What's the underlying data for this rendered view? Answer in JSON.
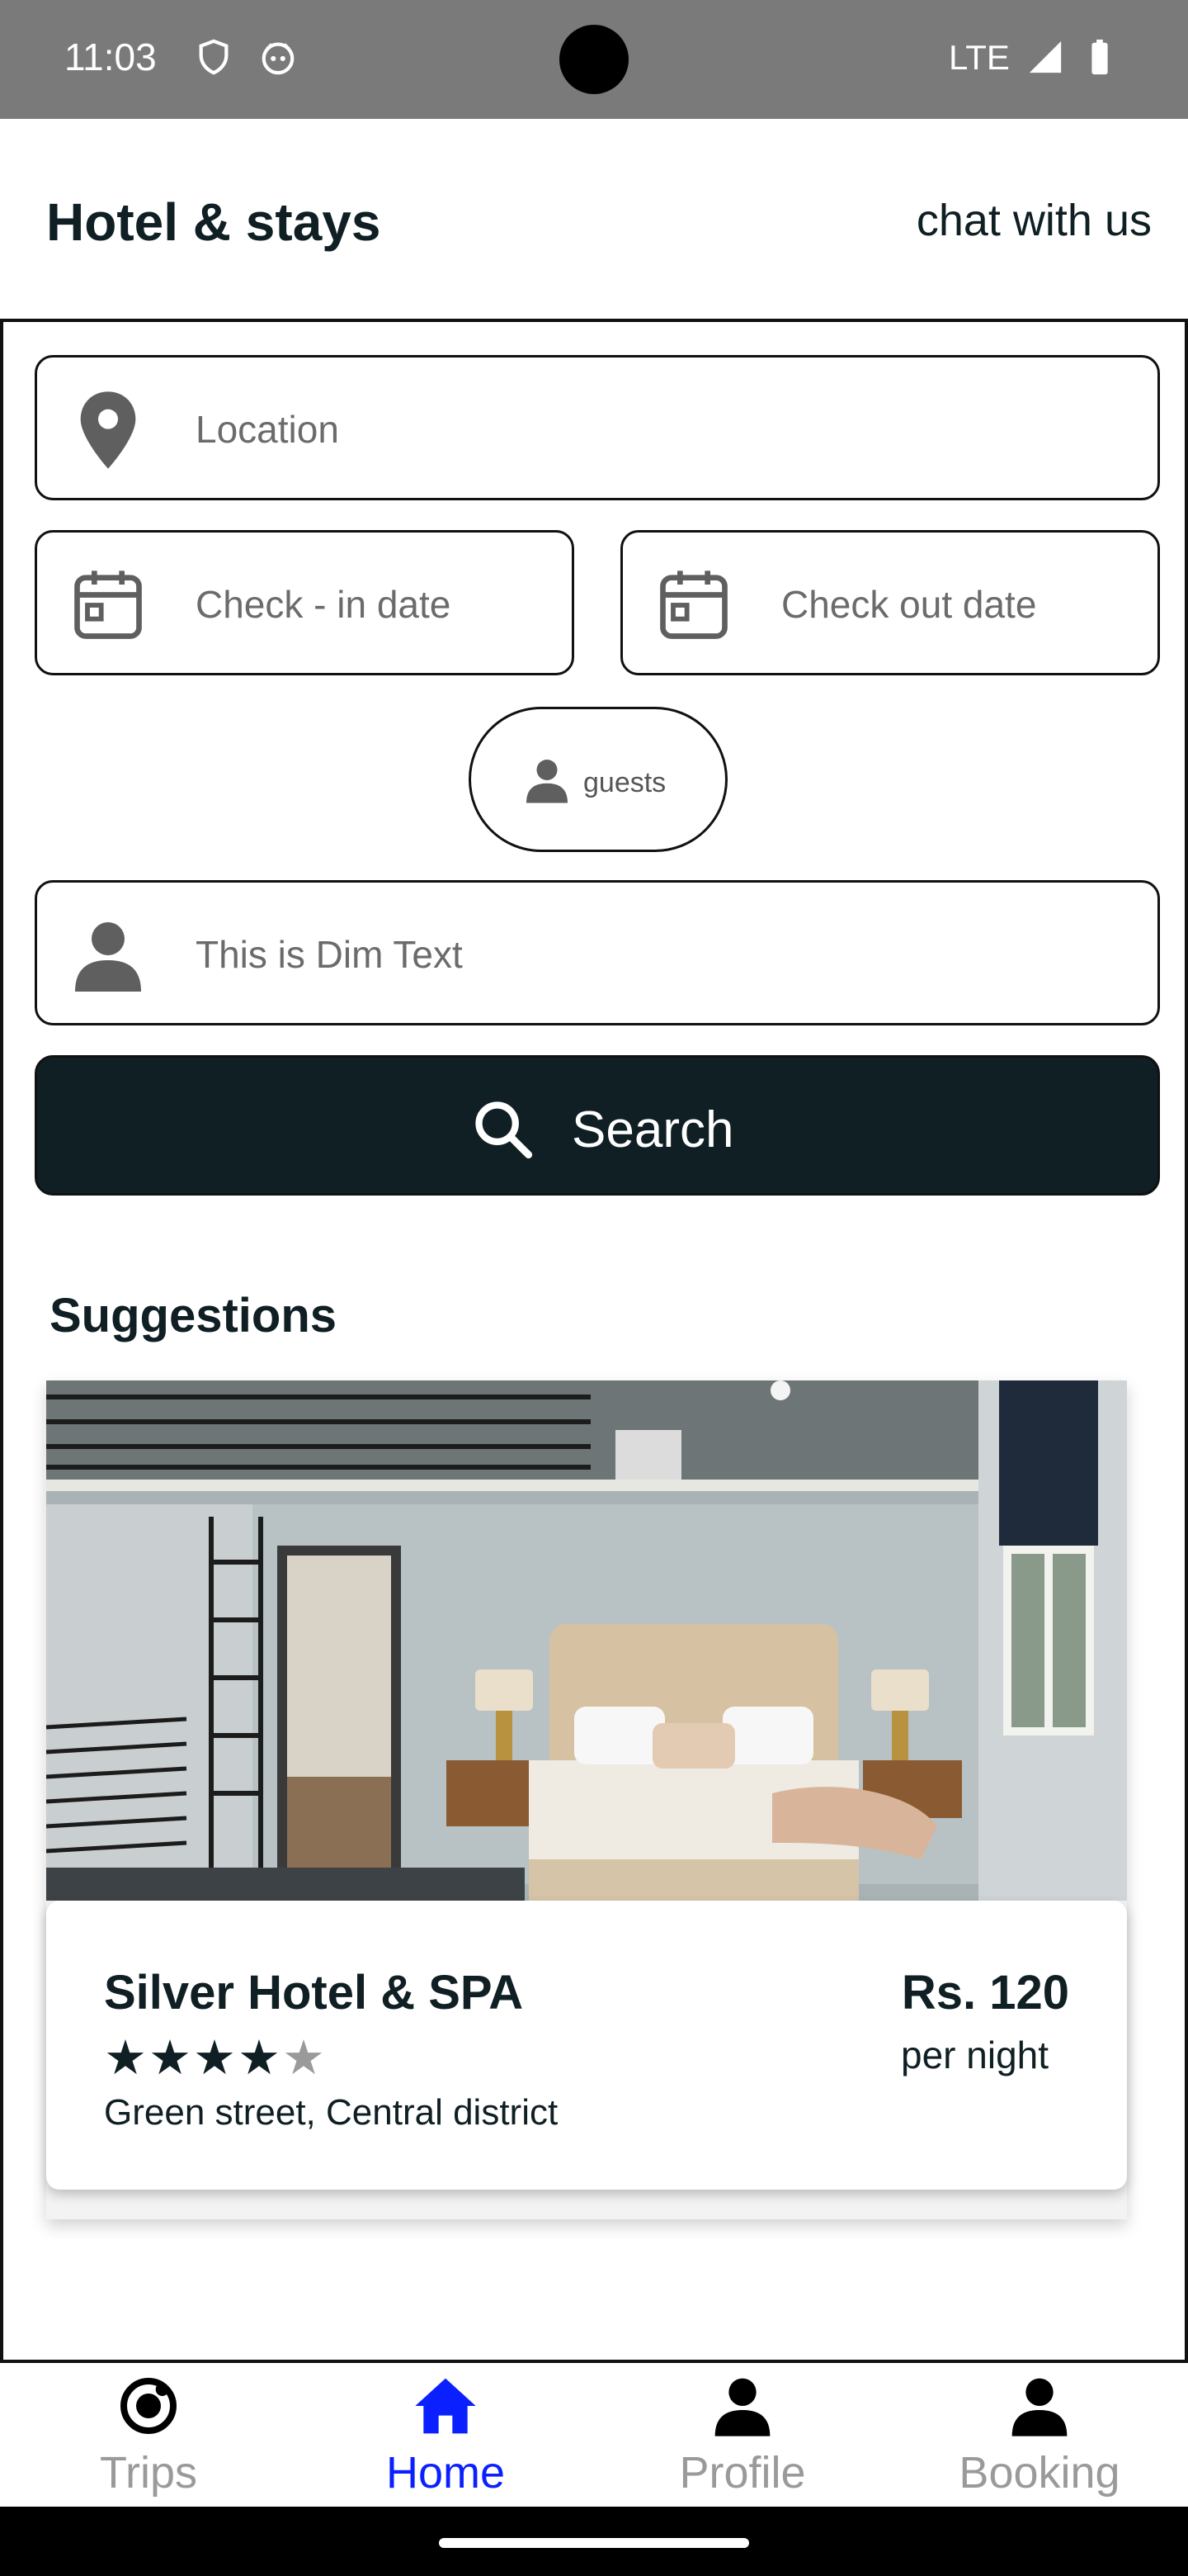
{
  "status_bar": {
    "time": "11:03",
    "network": "LTE",
    "icons": [
      "shield-icon",
      "face-icon",
      "signal-icon",
      "battery-icon"
    ]
  },
  "header": {
    "title": "Hotel & stays",
    "chat_link": "chat with us"
  },
  "form": {
    "location": {
      "placeholder": "Location",
      "icon": "location-pin-icon"
    },
    "check_in": {
      "placeholder": "Check - in date",
      "icon": "calendar-icon"
    },
    "check_out": {
      "placeholder": "Check out date",
      "icon": "calendar-icon"
    },
    "guests": {
      "label": "guests",
      "icon": "person-icon"
    },
    "extra": {
      "placeholder": "This is Dim Text",
      "icon": "person-icon"
    },
    "search_button": {
      "label": "Search",
      "icon": "search-icon"
    }
  },
  "suggestions": {
    "title": "Suggestions",
    "items": [
      {
        "name": "Silver Hotel & SPA",
        "rating": 4,
        "max_rating": 5,
        "address": "Green street, Central district",
        "price": "Rs. 120",
        "price_unit": "per night"
      }
    ]
  },
  "bottom_nav": {
    "items": [
      {
        "label": "Trips",
        "icon": "target-icon",
        "active": false
      },
      {
        "label": "Home",
        "icon": "home-icon",
        "active": true
      },
      {
        "label": "Profile",
        "icon": "person-icon",
        "active": false
      },
      {
        "label": "Booking",
        "icon": "person-icon",
        "active": false
      }
    ]
  },
  "colors": {
    "primary": "#0f1f24",
    "active_nav": "#0a20ff",
    "inactive_nav": "#9a9a9a",
    "status_bar": "#7a7a7a"
  }
}
